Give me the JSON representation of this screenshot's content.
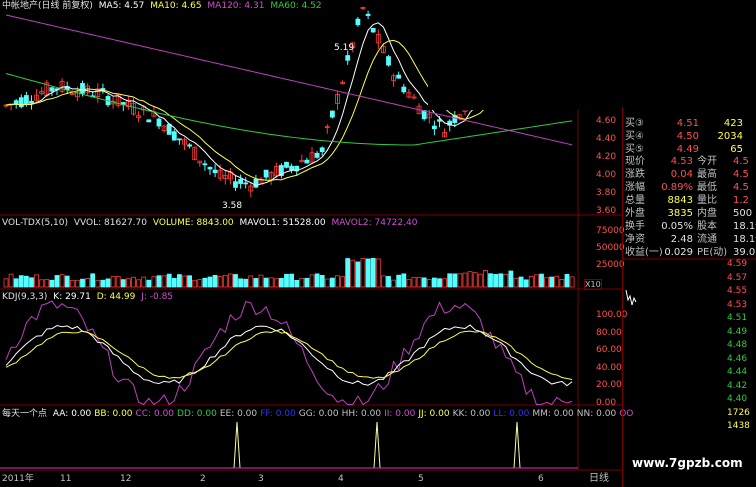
{
  "colors": {
    "bg": "#000000",
    "up": "#ff3b3b",
    "down": "#54ffff",
    "ma5": "#ffffff",
    "ma10": "#ffff4a",
    "ma120": "#c040c0",
    "ma60": "#2ecc40",
    "grid": "#7a0000"
  },
  "price_header": {
    "title": "中帐地产(日线 前复权)",
    "ma5": "MA5: 4.57",
    "ma10": "MA10: 4.65",
    "ma120": "MA120: 4.31",
    "ma60": "MA60: 4.52"
  },
  "price_annotations": {
    "high": "5.19",
    "low": "3.58"
  },
  "price_axis": [
    "4.60",
    "4.40",
    "4.20",
    "4.00",
    "3.80",
    "3.60"
  ],
  "volume_header": {
    "name": "VOL-TDX(5,10)",
    "vvol": "VVOL: 81627.70",
    "volume": "VOLUME: 8843.00",
    "mavol1": "MAVOL1: 51528.00",
    "mavol2": "MAVOL2: 74722.40"
  },
  "volume_axis": [
    "75000",
    "50000",
    "25000"
  ],
  "volume_unit": "X10",
  "kdj_header": {
    "name": "KDJ(9,3,3)",
    "k": "K: 29.71",
    "d": "D: 44.99",
    "j": "J: -0.85"
  },
  "kdj_axis": [
    "100.00",
    "80.00",
    "60.00",
    "40.00",
    "20.00",
    "0.00"
  ],
  "signal_header": {
    "name": "每天一个点",
    "items": [
      "AA: 0.00",
      "BB: 0.00",
      "CC: 0.00",
      "DD: 0.00",
      "EE: 0.00",
      "FF: 0.00",
      "GG: 0.00",
      "HH: 0.00",
      "II: 0.00",
      "JJ: 0.00",
      "KK: 0.00",
      "LL: 0.00",
      "MM: 0.00",
      "NN: 0.00",
      "OO"
    ]
  },
  "date_axis": [
    "2011年",
    "11",
    "12",
    "2",
    "3",
    "4",
    "5",
    "6"
  ],
  "order_book": {
    "sells": [
      {
        "label": "买③",
        "price": "4.51",
        "vol": "423"
      },
      {
        "label": "买④",
        "price": "4.50",
        "vol": "2034"
      },
      {
        "label": "买⑤",
        "price": "4.49",
        "vol": "65"
      }
    ]
  },
  "quote": [
    {
      "l1": "现价",
      "v1": "4.53",
      "l2": "今开",
      "v2": "4.5"
    },
    {
      "l1": "涨跌",
      "v1": "0.04",
      "l2": "最高",
      "v2": "4.5"
    },
    {
      "l1": "涨幅",
      "v1": "0.89%",
      "l2": "最低",
      "v2": "4.5"
    },
    {
      "l1": "总量",
      "v1": "8843",
      "l2": "量比",
      "v2": "1.2"
    },
    {
      "l1": "外盘",
      "v1": "3835",
      "l2": "内盘",
      "v2": "500"
    },
    {
      "l1": "换手",
      "v1": "0.05%",
      "l2": "股本",
      "v2": "18.1亿"
    },
    {
      "l1": "净资",
      "v1": "2.48",
      "l2": "流通",
      "v2": "18.1亿"
    },
    {
      "l1": "收益(一)",
      "v1": "0.029",
      "l2": "PE(动)",
      "v2": "39.0"
    }
  ],
  "intraday_axis": [
    "4.59",
    "4.57",
    "4.55",
    "4.53",
    "4.51",
    "4.49",
    "4.48",
    "4.46",
    "4.44",
    "4.42",
    "4.40",
    "1726",
    "1438"
  ],
  "bottom_tab": "日线",
  "watermark": "www.7gpzb.com"
}
